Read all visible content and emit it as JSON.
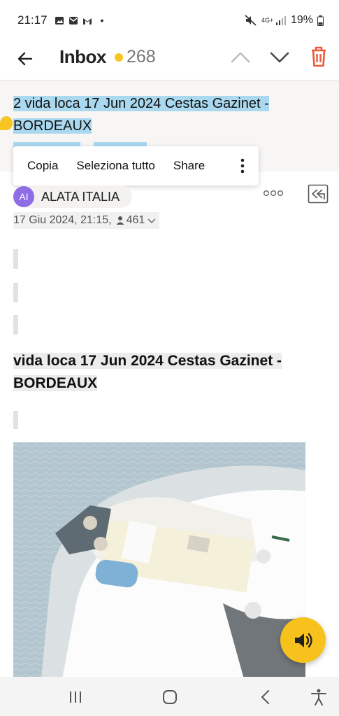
{
  "status_bar": {
    "time": "21:17",
    "network": "4G+",
    "battery": "19%"
  },
  "header": {
    "title": "Inbox",
    "unread_count": "268",
    "accent_color": "#f6c521",
    "delete_color": "#e85b3a"
  },
  "message": {
    "subject": "2 vida loca 17 Jun 2024 Cestas Gazinet - BORDEAUX",
    "sender_initials": "AI",
    "sender_name": "ALATA ITALIA",
    "date": "17 Giu 2024,",
    "time": "21:15,",
    "recipients": "461",
    "body_heading": " vida loca 17 Jun 2024 Cestas Gazinet - BORDEAUX"
  },
  "context_menu": {
    "copy": "Copia",
    "select_all": "Seleziona tutto",
    "share": "Share"
  },
  "icons": {
    "back": "arrow-left-icon",
    "prev": "chevron-up-icon",
    "next": "chevron-down-icon",
    "delete": "trash-icon",
    "more": "more-horizontal-icon",
    "reply_all": "reply-all-icon",
    "audio": "speaker-icon"
  }
}
